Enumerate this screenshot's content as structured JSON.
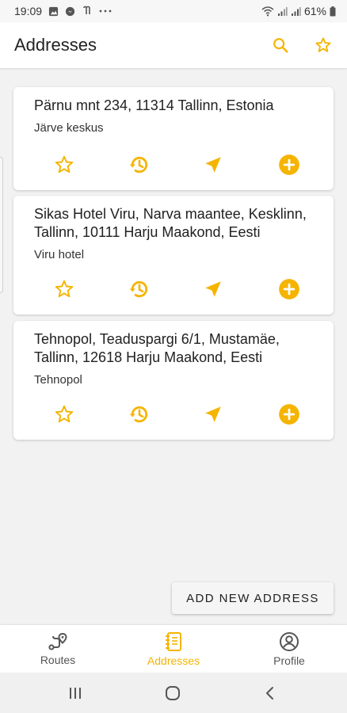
{
  "status_bar": {
    "time": "19:09",
    "battery": "61%",
    "left_icons": [
      "image-icon",
      "messenger-icon",
      "music-icon",
      "more-icon"
    ],
    "right_icons": [
      "wifi-icon",
      "signal-icon",
      "signal-icon",
      "battery-icon"
    ]
  },
  "app_bar": {
    "title": "Addresses",
    "actions": [
      "search-icon",
      "star-outline-icon"
    ]
  },
  "cards": [
    {
      "title": "Pärnu mnt 234, 11314 Tallinn, Estonia",
      "subtitle": "Järve keskus",
      "actions": [
        "favorite-star-icon",
        "history-icon",
        "navigate-icon",
        "add-circle-icon"
      ]
    },
    {
      "title": "Sikas Hotel Viru, Narva maantee, Kesklinn, Tallinn, 10111 Harju Maakond, Eesti",
      "subtitle": "Viru hotel",
      "actions": [
        "favorite-star-icon",
        "history-icon",
        "navigate-icon",
        "add-circle-icon"
      ]
    },
    {
      "title": "Tehnopol, Teaduspargi 6/1, Mustamäe, Tallinn, 12618 Harju Maakond, Eesti",
      "subtitle": "Tehnopol",
      "actions": [
        "favorite-star-icon",
        "history-icon",
        "navigate-icon",
        "add-circle-icon"
      ]
    }
  ],
  "add_button": {
    "label": "ADD NEW ADDRESS"
  },
  "bottom_nav": {
    "items": [
      {
        "label": "Routes",
        "icon": "routes-icon",
        "active": false
      },
      {
        "label": "Addresses",
        "icon": "addresses-icon",
        "active": true
      },
      {
        "label": "Profile",
        "icon": "profile-icon",
        "active": false
      }
    ]
  },
  "system_nav": [
    "recent-apps-icon",
    "home-icon",
    "back-icon"
  ],
  "colors": {
    "accent": "#F5B400",
    "background": "#F2F2F2",
    "card": "#FFFFFF",
    "text_primary": "#212121"
  }
}
